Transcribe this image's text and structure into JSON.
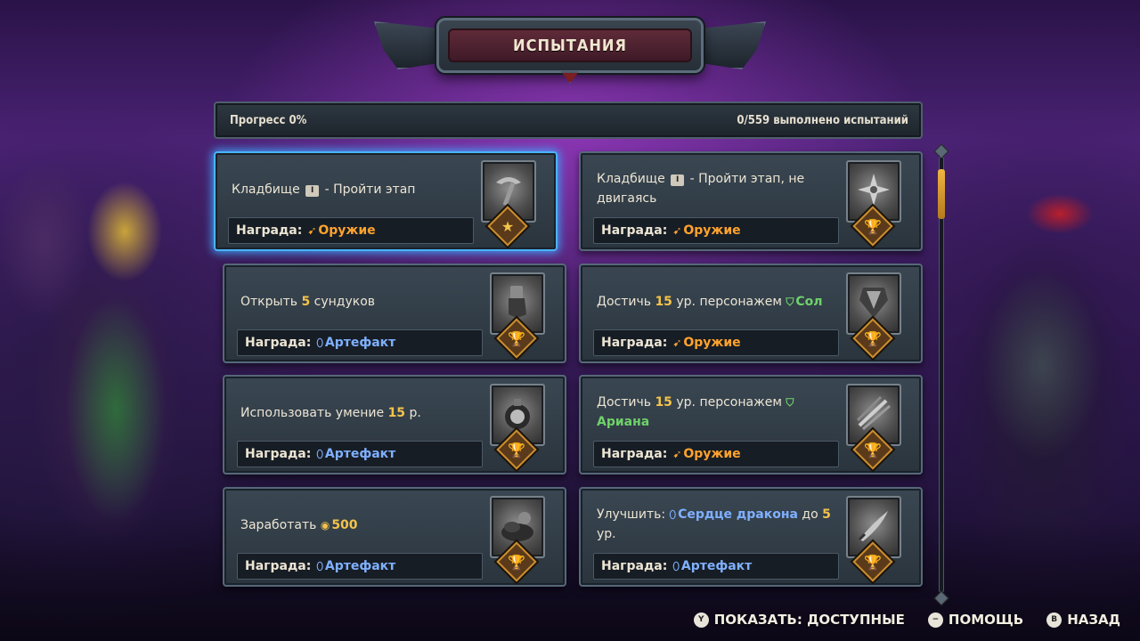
{
  "title": "ИСПЫТАНИЯ",
  "progress": {
    "label": "Прогресс 0%",
    "completed_text": "0/559 выполнено испытаний"
  },
  "reward_label": "Награда:",
  "cards": [
    {
      "task_before": "Кладбище",
      "badge": "I",
      "task_after": "- Пройти этап",
      "reward_type": "weapon",
      "reward_text": "Оружие",
      "medal": "star",
      "thumb_icon": "pickaxe-icon"
    },
    {
      "task_before": "Кладбище",
      "badge": "I",
      "task_after": "- Пройти этап, не двигаясь",
      "reward_type": "weapon",
      "reward_text": "Оружие",
      "medal": "trophy",
      "thumb_icon": "shuriken-icon"
    },
    {
      "task_before": "Открыть",
      "number": "5",
      "task_after": "сундуков",
      "reward_type": "artifact",
      "reward_text": "Артефакт",
      "medal": "trophy",
      "thumb_icon": "gauntlet-icon"
    },
    {
      "task_before": "Достичь",
      "number": "15",
      "task_after": "ур. персонажем",
      "hero": "Сол",
      "reward_type": "weapon",
      "reward_text": "Оружие",
      "medal": "trophy",
      "thumb_icon": "armor-icon"
    },
    {
      "task_before": "Использовать умение",
      "number": "15",
      "task_after": "р.",
      "reward_type": "artifact",
      "reward_text": "Артефакт",
      "medal": "trophy",
      "thumb_icon": "bomb-icon"
    },
    {
      "task_before": "Достичь",
      "number": "15",
      "task_after": "ур. персонажем",
      "hero": "Ариана",
      "reward_type": "weapon",
      "reward_text": "Оружие",
      "medal": "trophy",
      "thumb_icon": "claw-slash-icon"
    },
    {
      "task_before": "Заработать",
      "gold_amount": "500",
      "reward_type": "artifact",
      "reward_text": "Артефакт",
      "medal": "trophy",
      "thumb_icon": "coin-pile-icon"
    },
    {
      "task_before": "Улучшить:",
      "artifact": "Сердце дракона",
      "task_mid": "до",
      "number": "5",
      "task_after": "ур.",
      "reward_type": "artifact",
      "reward_text": "Артефакт",
      "medal": "trophy",
      "thumb_icon": "blade-icon"
    }
  ],
  "medal_glyphs": {
    "star": "★",
    "trophy": "🏆"
  },
  "footer": {
    "show": {
      "button": "Y",
      "label": "ПОКАЗАТЬ: ДОСТУПНЫЕ"
    },
    "help": {
      "button": "−",
      "label": "ПОМОЩЬ"
    },
    "back": {
      "button": "B",
      "label": "НАЗАД"
    }
  },
  "colors": {
    "accent_orange": "#ffa22e",
    "accent_blue": "#7fb0ff",
    "accent_green": "#6fd16a",
    "number_gold": "#f3c34a",
    "selection_glow": "#49b4ff"
  }
}
